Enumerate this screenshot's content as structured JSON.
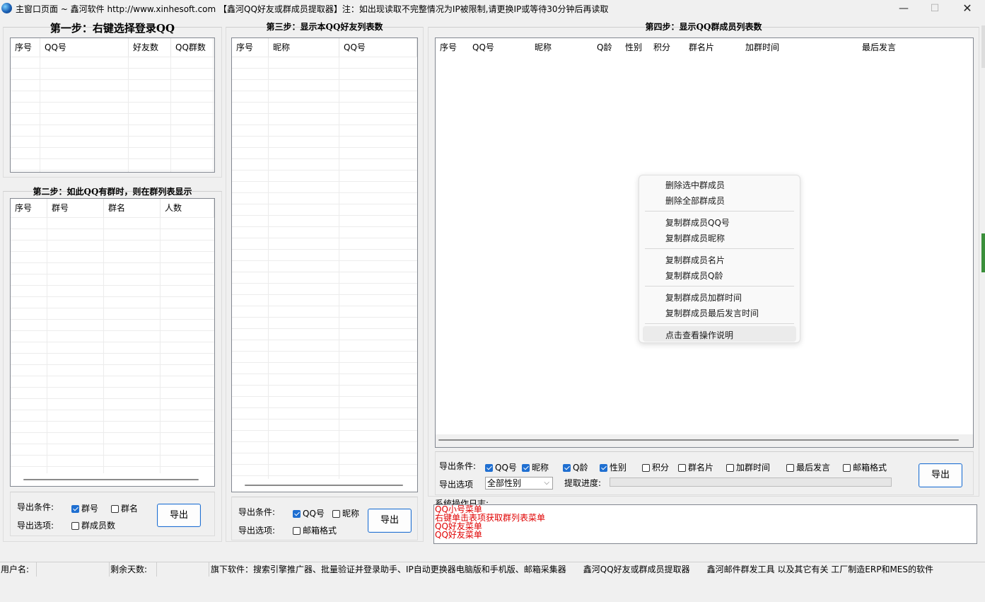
{
  "window": {
    "title": "主窗口页面 ~ 鑫河软件 http://www.xinhesoft.com 【鑫河QQ好友或群成员提取器】注：如出现读取不完整情况为IP被限制,请更换IP或等待30分钟后再读取",
    "min_glyph": "—",
    "max_glyph": "☐",
    "close_glyph": "✕"
  },
  "step1": {
    "title": "第一步：右键选择登录QQ",
    "columns": [
      "序号",
      "QQ号",
      "好友数",
      "QQ群数"
    ]
  },
  "step2": {
    "title": "第二步：如此QQ有群时，则在群列表显示",
    "columns": [
      "序号",
      "群号",
      "群名",
      "人数"
    ],
    "export_label": "导出条件:",
    "options_label": "导出选项:",
    "cb_group_no": "群号",
    "cb_group_name": "群名",
    "cb_member_count": "群成员数",
    "export_button": "导出"
  },
  "step3": {
    "title": "第三步：显示本QQ好友列表数",
    "columns": [
      "序号",
      "昵称",
      "QQ号"
    ],
    "export_label": "导出条件:",
    "options_label": "导出选项:",
    "cb_qq": "QQ号",
    "cb_nick": "昵称",
    "cb_email": "邮箱格式",
    "export_button": "导出"
  },
  "step4": {
    "title": "第四步：显示QQ群成员列表数",
    "columns": [
      "序号",
      "QQ号",
      "昵称",
      "Q龄",
      "性别",
      "积分",
      "群名片",
      "加群时间",
      "最后发言"
    ],
    "export_label": "导出条件:",
    "options_label": "导出选项",
    "cb_qq": "QQ号",
    "cb_nick": "昵称",
    "cb_qage": "Q龄",
    "cb_gender": "性别",
    "cb_points": "积分",
    "cb_card": "群名片",
    "cb_join_time": "加群时间",
    "cb_last_speak": "最后发言",
    "cb_email": "邮箱格式",
    "gender_select": "全部性别",
    "progress_label": "提取进度:",
    "progress_value": 0,
    "export_button": "导出"
  },
  "context_menu": {
    "items": [
      "删除选中群成员",
      "删除全部群成员",
      "复制群成员QQ号",
      "复制群成员昵称",
      "复制群成员名片",
      "复制群成员Q龄",
      "复制群成员加群时间",
      "复制群成员最后发言时间",
      "点击查看操作说明"
    ]
  },
  "log": {
    "label": "系统操作日志:",
    "lines": [
      "QQ小号菜单",
      "右键单击表项获取群列表菜单",
      "QQ好友菜单",
      "QQ好友菜单"
    ]
  },
  "statusbar": {
    "user_label": "用户名:",
    "user_value": "",
    "days_label": "剩余天数:",
    "days_value": "",
    "software": "旗下软件：搜索引擎推广器、批量验证并登录助手、IP自动更换器电脑版和手机版、邮箱采集器　　鑫河QQ好友或群成员提取器　　鑫河邮件群发工具 以及其它有关 工厂制造ERP和MES的软件"
  },
  "colors": {
    "accent": "#1f6fd1",
    "log_text": "#e00000",
    "window_bg": "#f0f0f0"
  }
}
